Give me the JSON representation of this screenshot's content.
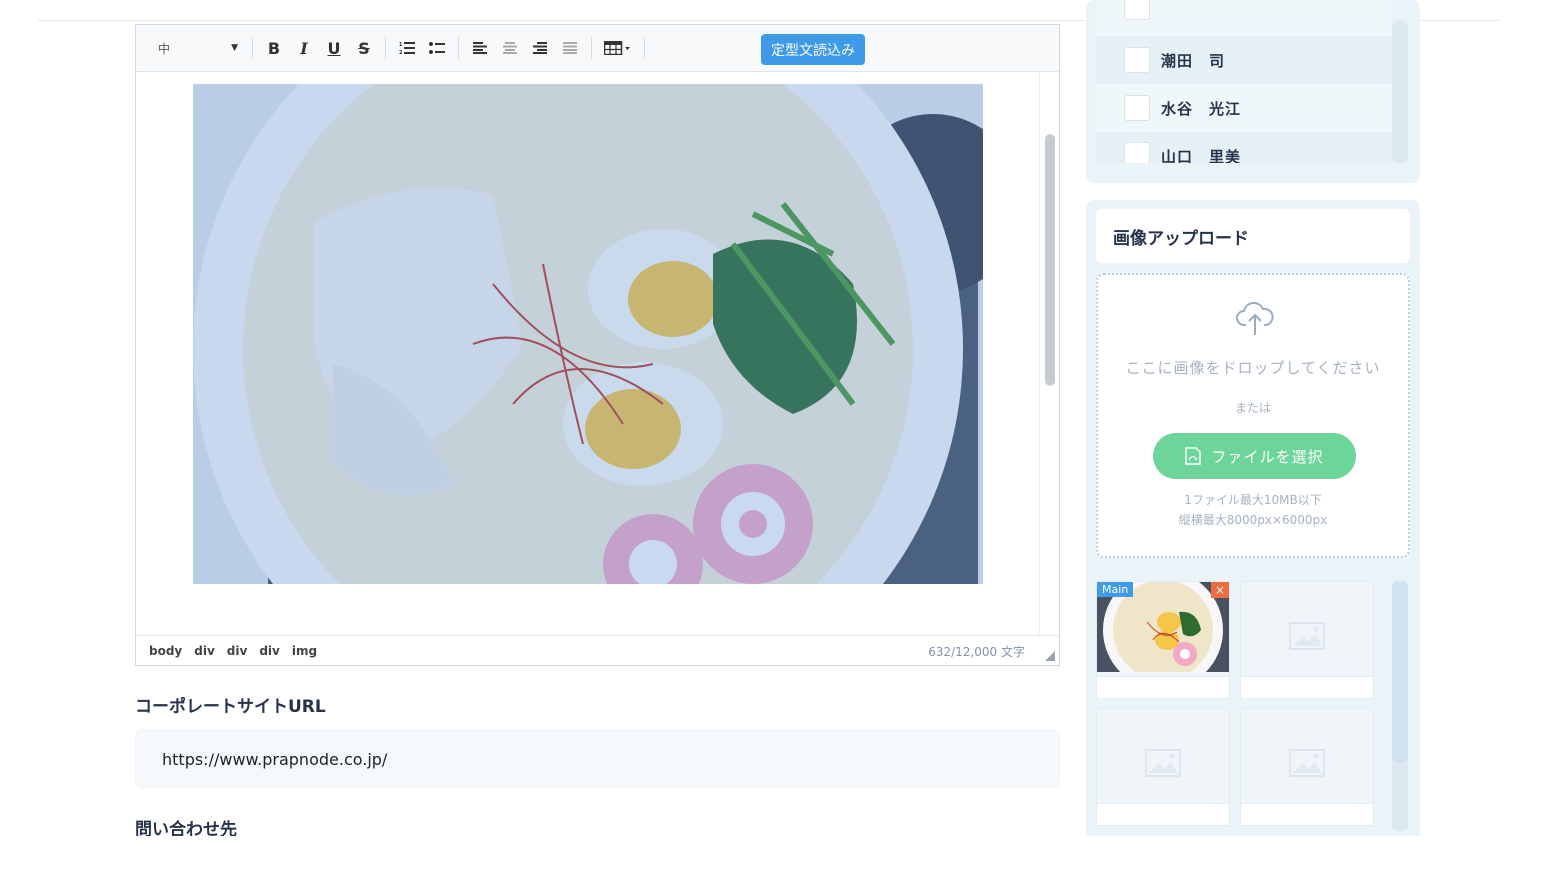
{
  "editor": {
    "toolbar": {
      "font_size_value": "中",
      "bold_label": "B",
      "italic_label": "I",
      "underline_label": "U",
      "strike_label": "S",
      "icons": [
        "ordered-list-icon",
        "bullet-list-icon",
        "align-left-icon",
        "align-center-icon",
        "align-right-icon",
        "align-justify-icon",
        "table-icon"
      ],
      "template_button": "定型文読込み"
    },
    "image_subject": "ramen-bowl",
    "breadcrumbs": [
      "body",
      "div",
      "div",
      "div",
      "img"
    ],
    "word_count": "632/12,000 文字"
  },
  "corporate_url": {
    "label": "コーポレートサイトURL",
    "value": "https://www.prapnode.co.jp/"
  },
  "contact": {
    "label": "問い合わせ先"
  },
  "member_list": {
    "items": [
      {
        "name": "潮田　司"
      },
      {
        "name": "水谷　光江"
      },
      {
        "name": "山口　里美"
      }
    ]
  },
  "image_upload": {
    "title": "画像アップロード",
    "drop_text": "ここに画像をドロップしてください",
    "or_text": "または",
    "select_button": "ファイルを選択",
    "note_size": "1ファイル最大10MB以下",
    "note_dimensions": "縦横最大8000px×6000px",
    "thumbnails": {
      "main_badge": "Main",
      "close_icon": "×"
    }
  },
  "colors": {
    "accent_blue": "#3f9ae8",
    "upload_green": "#6dd49a",
    "sidebar_bg": "#e9f3f8",
    "close_orange": "#ec6e3f"
  }
}
